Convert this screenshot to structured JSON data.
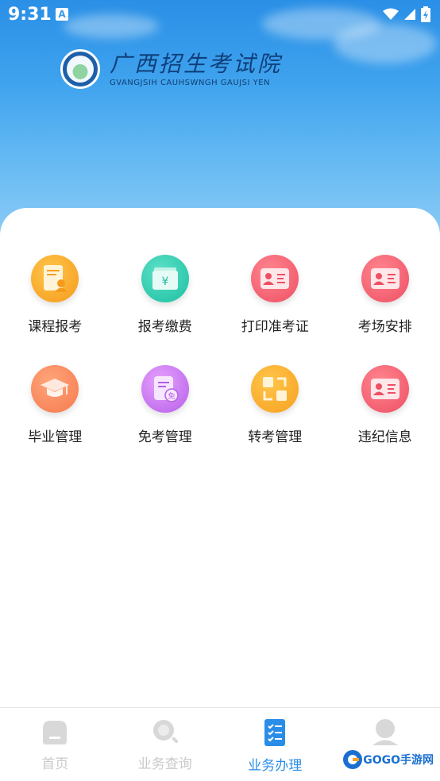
{
  "status_bar": {
    "time": "9:31",
    "notification_badge": "A"
  },
  "header": {
    "title": "广西招生考试院",
    "subtitle": "GVANGJSIH CAUHSWNGH GAUJSI YEN"
  },
  "services": [
    {
      "label": "课程报考",
      "icon": "course-register-icon",
      "color": "#f7a321"
    },
    {
      "label": "报考缴费",
      "icon": "fee-payment-icon",
      "color": "#22c4a6"
    },
    {
      "label": "打印准考证",
      "icon": "admission-card-icon",
      "color": "#ef5568"
    },
    {
      "label": "考场安排",
      "icon": "exam-room-icon",
      "color": "#ef5568"
    },
    {
      "label": "毕业管理",
      "icon": "graduation-cap-icon",
      "color": "#f57f52"
    },
    {
      "label": "免考管理",
      "icon": "exemption-icon",
      "color": "#b965e9"
    },
    {
      "label": "转考管理",
      "icon": "transfer-icon",
      "color": "#f7a321"
    },
    {
      "label": "违纪信息",
      "icon": "violation-info-icon",
      "color": "#ef5568"
    }
  ],
  "tabs": [
    {
      "label": "首页",
      "icon": "home-icon",
      "active": false
    },
    {
      "label": "业务查询",
      "icon": "search-icon",
      "active": false
    },
    {
      "label": "业务办理",
      "icon": "checklist-icon",
      "active": true
    },
    {
      "label": "",
      "icon": "user-icon",
      "active": false
    }
  ],
  "watermark": {
    "text": "GOGO手游网"
  },
  "colors": {
    "accent": "#2a8ee8",
    "header_top": "#2a8fe6",
    "inactive_tab": "#c9c9c9"
  }
}
